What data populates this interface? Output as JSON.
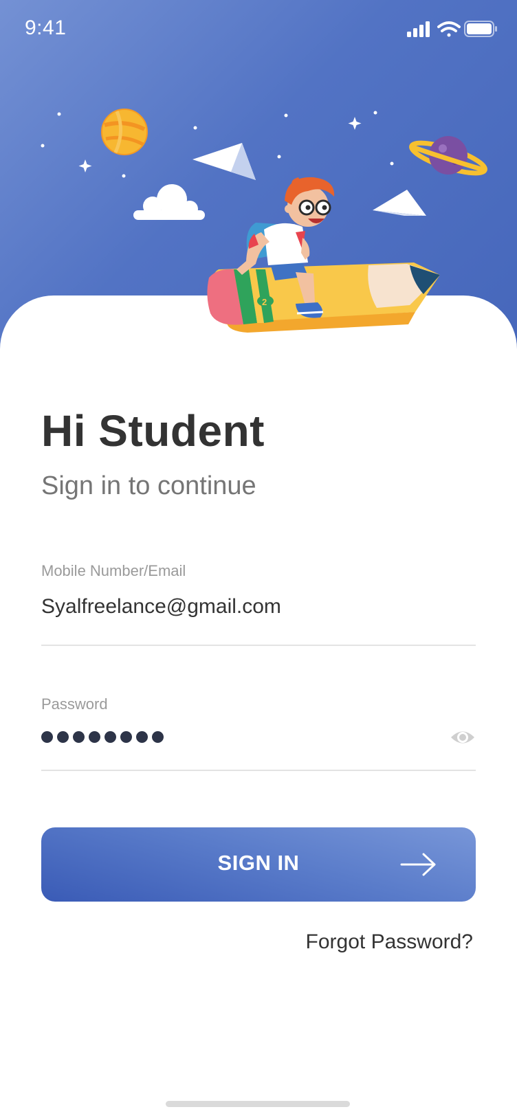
{
  "status_bar": {
    "time": "9:41",
    "icons": [
      "signal-icon",
      "wifi-icon",
      "battery-icon"
    ]
  },
  "hero": {
    "illustration": "student-riding-pencil-in-space",
    "decorations": [
      "orange-planet-icon",
      "purple-ringed-planet-icon",
      "cloud-icon",
      "paper-plane-icon",
      "stars-icon"
    ],
    "pencil_badge": "2"
  },
  "login": {
    "title": "Hi Student",
    "subtitle": "Sign in to continue",
    "email_label": "Mobile Number/Email",
    "email_value": "Syalfreelance@gmail.com",
    "password_label": "Password",
    "password_length": 8,
    "sign_in_label": "SIGN IN",
    "forgot_label": "Forgot Password?"
  },
  "colors": {
    "hero_start": "#7491d4",
    "hero_end": "#4667bb",
    "button_start": "#3a5bb6",
    "button_end": "#7896d8",
    "title": "#333333",
    "subtitle": "#757575",
    "label": "#9a9a9a",
    "password_dot": "#2d3448"
  }
}
